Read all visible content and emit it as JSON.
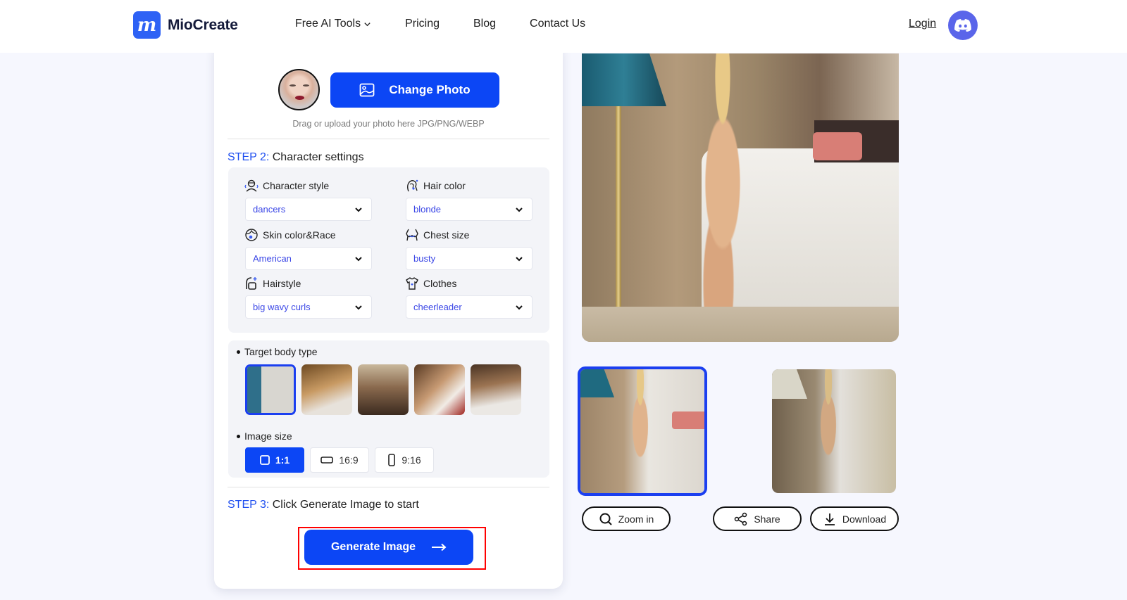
{
  "header": {
    "brand": "MioCreate",
    "logo_glyph": "m",
    "nav": [
      {
        "label": "Free AI Tools",
        "has_dropdown": true
      },
      {
        "label": "Pricing"
      },
      {
        "label": "Blog"
      },
      {
        "label": "Contact Us"
      }
    ],
    "login_label": "Login",
    "discord_icon": "discord-icon"
  },
  "upload": {
    "change_photo_label": "Change Photo",
    "hint": "Drag or upload your photo here JPG/PNG/WEBP"
  },
  "step2": {
    "num": "STEP 2:",
    "title": " Character settings",
    "fields": [
      {
        "label": "Character style",
        "value": "dancers",
        "icon": "character-style-icon"
      },
      {
        "label": "Hair color",
        "value": "blonde",
        "icon": "hair-color-icon"
      },
      {
        "label": "Skin color&Race",
        "value": "American",
        "icon": "skin-color-icon"
      },
      {
        "label": "Chest size",
        "value": "busty",
        "icon": "chest-size-icon"
      },
      {
        "label": "Hairstyle",
        "value": "big wavy curls",
        "icon": "hairstyle-icon"
      },
      {
        "label": "Clothes",
        "value": "cheerleader",
        "icon": "clothes-icon"
      }
    ],
    "body_type_label": "Target body type",
    "body_type_selected_index": 0,
    "body_type_count": 5,
    "image_size_label": "Image size",
    "image_sizes": [
      {
        "label": "1:1",
        "active": true
      },
      {
        "label": "16:9",
        "active": false
      },
      {
        "label": "9:16",
        "active": false
      }
    ]
  },
  "step3": {
    "num": "STEP 3:",
    "title": " Click Generate Image to start",
    "generate_label": "Generate Image"
  },
  "result": {
    "actions": {
      "zoom_in": "Zoom in",
      "share": "Share",
      "download": "Download"
    },
    "selected_preview_index": 0
  },
  "colors": {
    "accent": "#0c46f5",
    "select_text": "#3a46e6",
    "highlight_outline": "#ff0000",
    "page_bg": "#f6f7fe"
  }
}
